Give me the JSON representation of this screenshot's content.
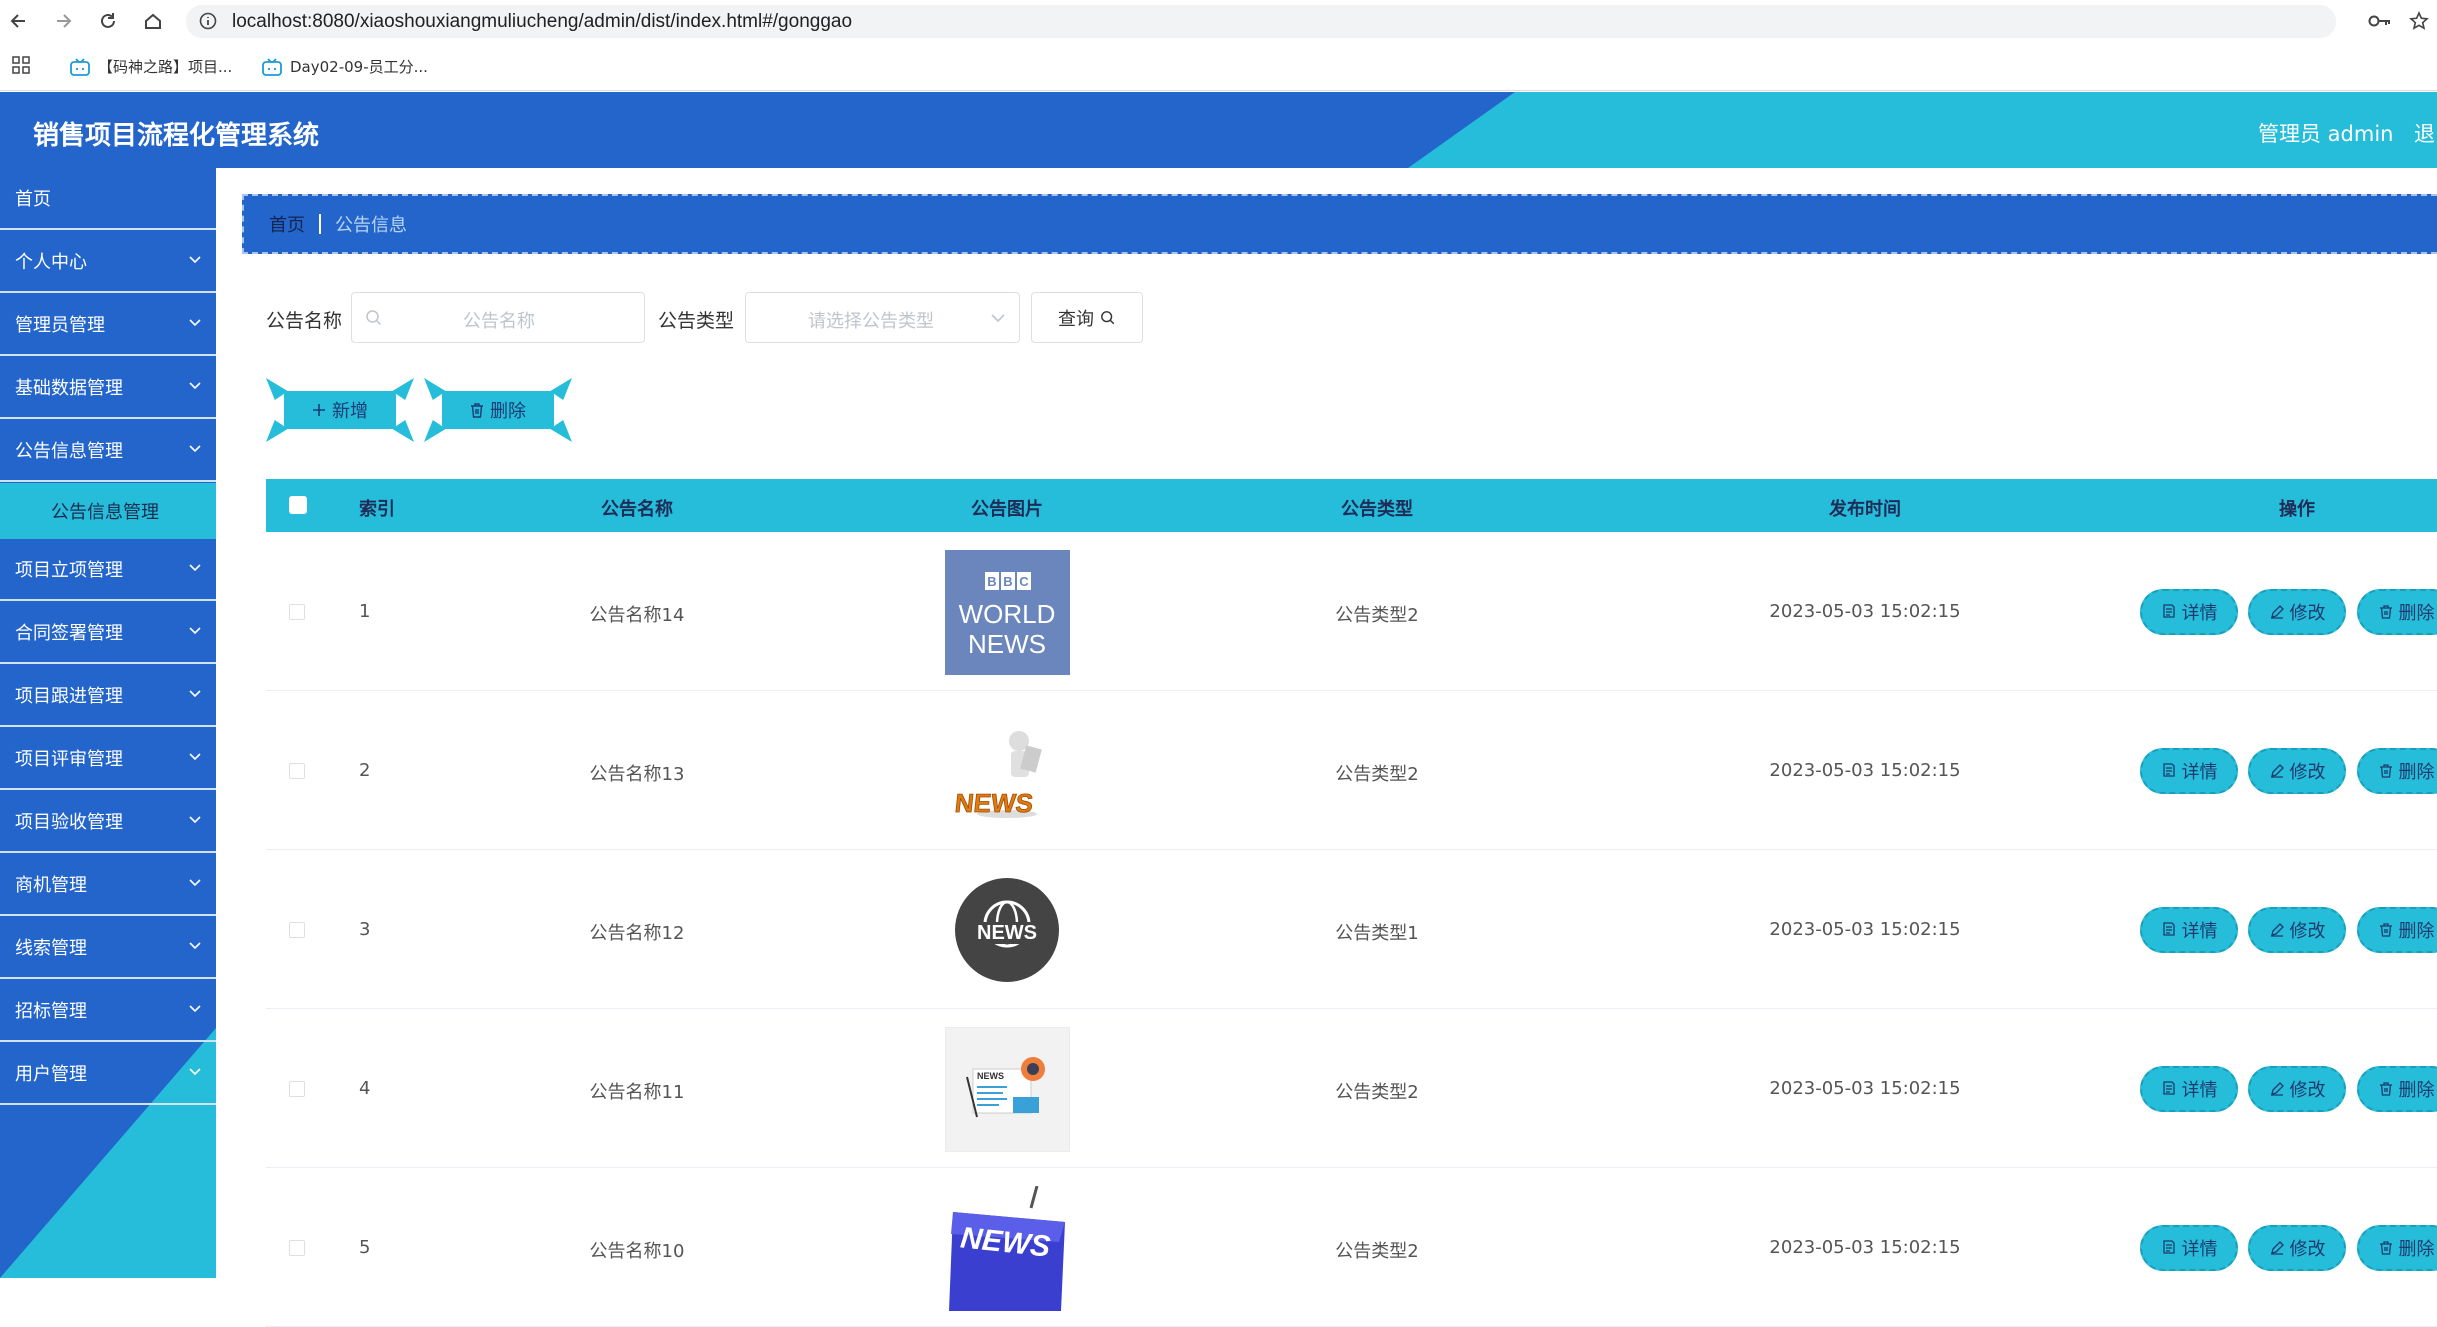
{
  "browser": {
    "url": "localhost:8080/xiaoshouxiangmuliucheng/admin/dist/index.html#/gonggao",
    "bookmarks": [
      "【码神之路】项目...",
      "Day02-09-员工分..."
    ]
  },
  "header": {
    "title": "销售项目流程化管理系统",
    "user": "管理员 admin",
    "logout": "退"
  },
  "sidebar": {
    "items": [
      {
        "label": "首页",
        "chevron": false
      },
      {
        "label": "个人中心",
        "chevron": true
      },
      {
        "label": "管理员管理",
        "chevron": true
      },
      {
        "label": "基础数据管理",
        "chevron": true
      },
      {
        "label": "公告信息管理",
        "chevron": true
      },
      {
        "label": "项目立项管理",
        "chevron": true
      },
      {
        "label": "合同签署管理",
        "chevron": true
      },
      {
        "label": "项目跟进管理",
        "chevron": true
      },
      {
        "label": "项目评审管理",
        "chevron": true
      },
      {
        "label": "项目验收管理",
        "chevron": true
      },
      {
        "label": "商机管理",
        "chevron": true
      },
      {
        "label": "线索管理",
        "chevron": true
      },
      {
        "label": "招标管理",
        "chevron": true
      },
      {
        "label": "用户管理",
        "chevron": true
      }
    ],
    "sub_item": "公告信息管理"
  },
  "breadcrumb": {
    "home": "首页",
    "current": "公告信息"
  },
  "filters": {
    "name_label": "公告名称",
    "name_placeholder": "公告名称",
    "type_label": "公告类型",
    "type_placeholder": "请选择公告类型",
    "query_label": "查询"
  },
  "actions": {
    "add_label": "新增",
    "delete_label": "删除"
  },
  "table": {
    "columns": [
      "索引",
      "公告名称",
      "公告图片",
      "公告类型",
      "发布时间",
      "操作"
    ],
    "rows": [
      {
        "index": "1",
        "name": "公告名称14",
        "image": "bbc-world-news",
        "type": "公告类型2",
        "time": "2023-05-03 15:02:15"
      },
      {
        "index": "2",
        "name": "公告名称13",
        "image": "news-figure",
        "type": "公告类型2",
        "time": "2023-05-03 15:02:15"
      },
      {
        "index": "3",
        "name": "公告名称12",
        "image": "news-globe",
        "type": "公告类型1",
        "time": "2023-05-03 15:02:15"
      },
      {
        "index": "4",
        "name": "公告名称11",
        "image": "news-paper",
        "type": "公告类型2",
        "time": "2023-05-03 15:02:15"
      },
      {
        "index": "5",
        "name": "公告名称10",
        "image": "news-key",
        "type": "公告类型2",
        "time": "2023-05-03 15:02:15"
      }
    ],
    "row_actions": {
      "detail": "详情",
      "edit": "修改",
      "delete": "删除"
    }
  },
  "thumb_text": {
    "bbc": [
      "B",
      "B",
      "C"
    ],
    "world": "WORLD",
    "news_upper": "NEWS",
    "news_key": "NEWS"
  },
  "colors": {
    "primary_blue": "#2465cc",
    "accent_cyan": "#25bdda"
  }
}
